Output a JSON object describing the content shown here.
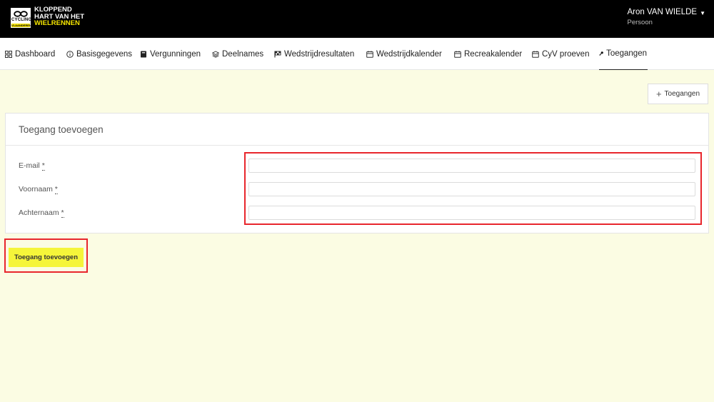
{
  "brand": {
    "badge_text": "CYCLING",
    "badge_sub": "VLAANDEREN",
    "line1": "KLOPPEND",
    "line2": "HART VAN HET",
    "line3": "WIELRENNEN"
  },
  "user": {
    "name": "Aron VAN WIELDE",
    "role": "Persoon"
  },
  "nav": {
    "items": [
      {
        "label": "Dashboard",
        "icon": "grid-icon"
      },
      {
        "label": "Basisgegevens",
        "icon": "info-circle-icon"
      },
      {
        "label": "Vergunningen",
        "icon": "book-icon"
      },
      {
        "label": "Deelnames",
        "icon": "layers-icon"
      },
      {
        "label": "Wedstrijdresultaten",
        "icon": "flag-icon"
      },
      {
        "label": "Wedstrijdkalender",
        "icon": "calendar-icon"
      },
      {
        "label": "Recreakalender",
        "icon": "calendar-icon"
      },
      {
        "label": "CyV proeven",
        "icon": "calendar-icon"
      },
      {
        "label": "Toegangen",
        "icon": "key-icon",
        "active": true
      }
    ]
  },
  "actions": {
    "add_access_label": "Toegangen"
  },
  "form": {
    "title": "Toegang toevoegen",
    "fields": [
      {
        "label": "E-mail",
        "required_mark": "*",
        "value": "",
        "placeholder": ""
      },
      {
        "label": "Voornaam",
        "required_mark": "*",
        "value": "",
        "placeholder": ""
      },
      {
        "label": "Achternaam",
        "required_mark": "*",
        "value": "",
        "placeholder": ""
      }
    ],
    "submit_label": "Toegang toevoegen"
  },
  "colors": {
    "accent_yellow": "#f5f53a",
    "page_background": "#fbfce3",
    "highlight_red": "#e8262c",
    "topbar": "#000000"
  }
}
